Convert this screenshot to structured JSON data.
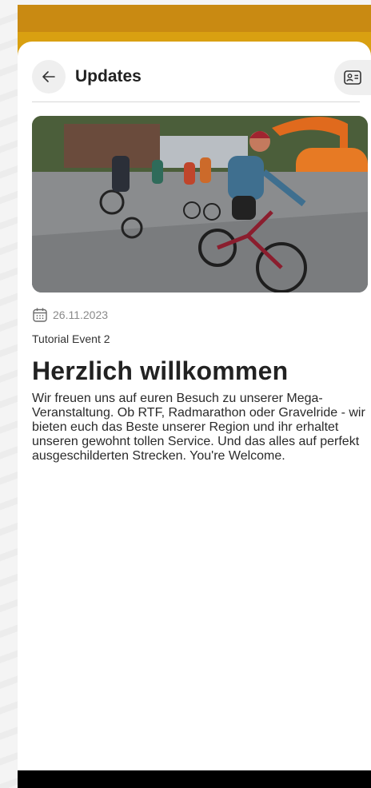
{
  "header": {
    "title": "Updates"
  },
  "post": {
    "date": "26.11.2023",
    "event_name": "Tutorial Event 2",
    "headline": "Herzlich willkommen",
    "body": "Wir freuen uns auf euren Besuch zu unserer Mega-Veranstaltung. Ob RTF, Radmarathon oder Gravelride - wir bieten euch das Beste unserer Region und ihr erhaltet unseren gewohnt tollen Service. Und das alles auf perfekt ausgeschilderten Strecken. You're Welcome."
  },
  "icons": {
    "back": "arrow-left-icon",
    "contact": "contact-card-icon",
    "calendar": "calendar-icon"
  },
  "colors": {
    "accent_bar": "#d9a011",
    "sheet": "#ffffff",
    "chip_bg": "#efefef"
  }
}
